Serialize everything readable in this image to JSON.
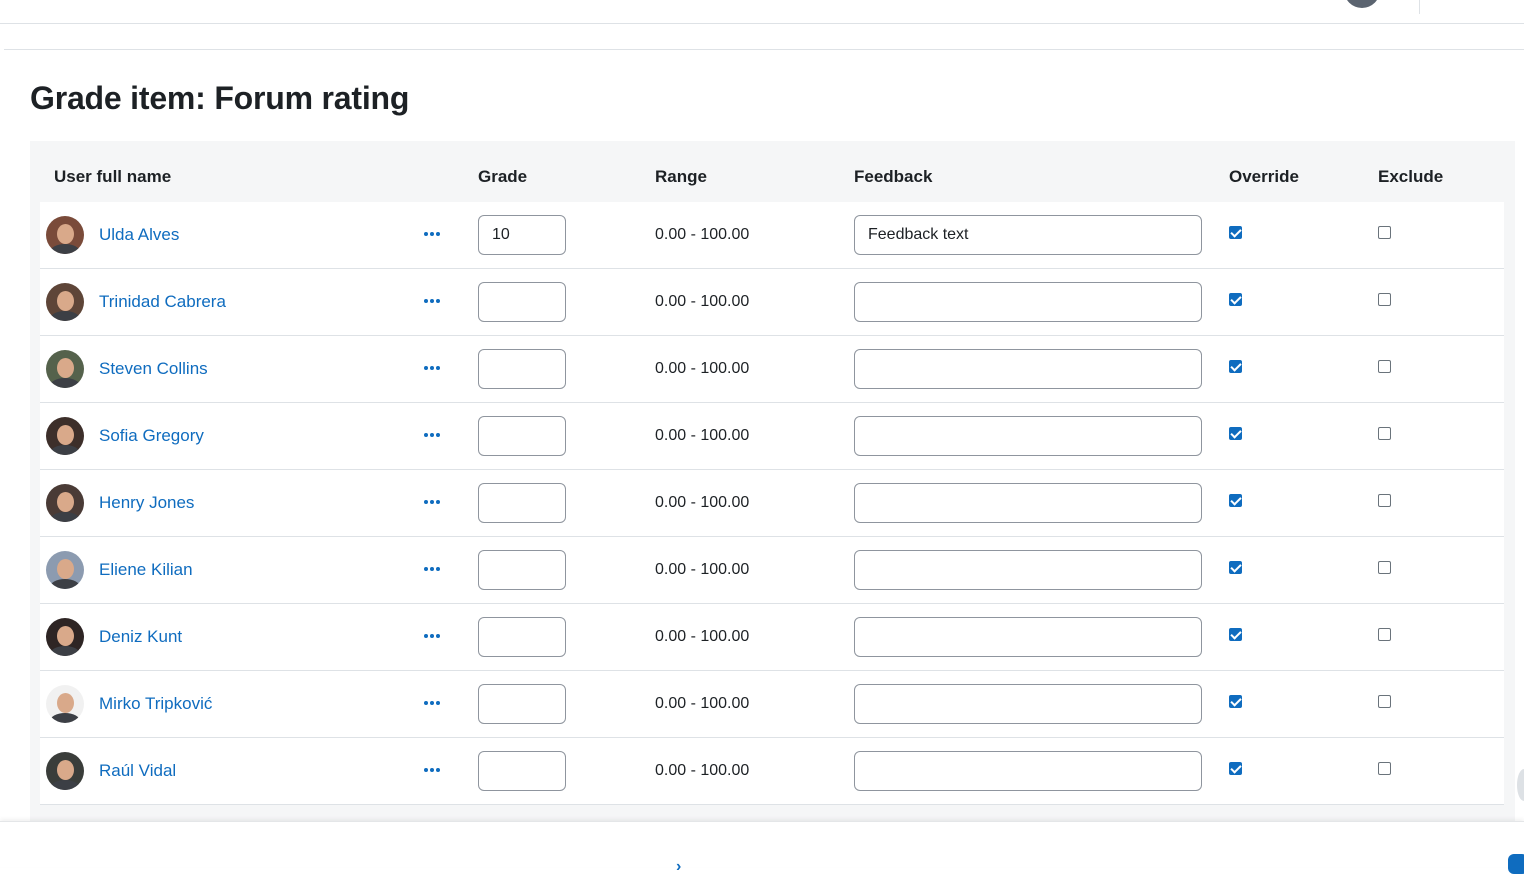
{
  "page": {
    "title": "Grade item: Forum rating"
  },
  "table": {
    "headers": {
      "name": "User full name",
      "grade": "Grade",
      "range": "Range",
      "feedback": "Feedback",
      "override": "Override",
      "exclude": "Exclude"
    },
    "rows": [
      {
        "name": "Ulda Alves",
        "grade": "10",
        "range": "0.00 - 100.00",
        "feedback": "Feedback text",
        "override": true,
        "exclude": false
      },
      {
        "name": "Trinidad Cabrera",
        "grade": "",
        "range": "0.00 - 100.00",
        "feedback": "",
        "override": true,
        "exclude": false
      },
      {
        "name": "Steven Collins",
        "grade": "",
        "range": "0.00 - 100.00",
        "feedback": "",
        "override": true,
        "exclude": false
      },
      {
        "name": "Sofia Gregory",
        "grade": "",
        "range": "0.00 - 100.00",
        "feedback": "",
        "override": true,
        "exclude": false
      },
      {
        "name": "Henry Jones",
        "grade": "",
        "range": "0.00 - 100.00",
        "feedback": "",
        "override": true,
        "exclude": false
      },
      {
        "name": "Eliene Kilian",
        "grade": "",
        "range": "0.00 - 100.00",
        "feedback": "",
        "override": true,
        "exclude": false
      },
      {
        "name": "Deniz Kunt",
        "grade": "",
        "range": "0.00 - 100.00",
        "feedback": "",
        "override": true,
        "exclude": false
      },
      {
        "name": "Mirko Tripković",
        "grade": "",
        "range": "0.00 - 100.00",
        "feedback": "",
        "override": true,
        "exclude": false
      },
      {
        "name": "Raúl Vidal",
        "grade": "",
        "range": "0.00 - 100.00",
        "feedback": "",
        "override": true,
        "exclude": false
      }
    ],
    "avatar_colors": [
      "#7a4b3a",
      "#5e4538",
      "#55624c",
      "#3d2f2a",
      "#4a3b36",
      "#8c9bb0",
      "#2e2524",
      "#f1f1f1",
      "#3a3d3a"
    ]
  },
  "colors": {
    "link": "#0f6cbf",
    "checkbox_checked": "#0f6cbf",
    "table_bg": "#f5f6f7"
  },
  "icons": {
    "row_menu": "ellipsis-horizontal-icon",
    "more_link": "chevron-right-icon"
  }
}
